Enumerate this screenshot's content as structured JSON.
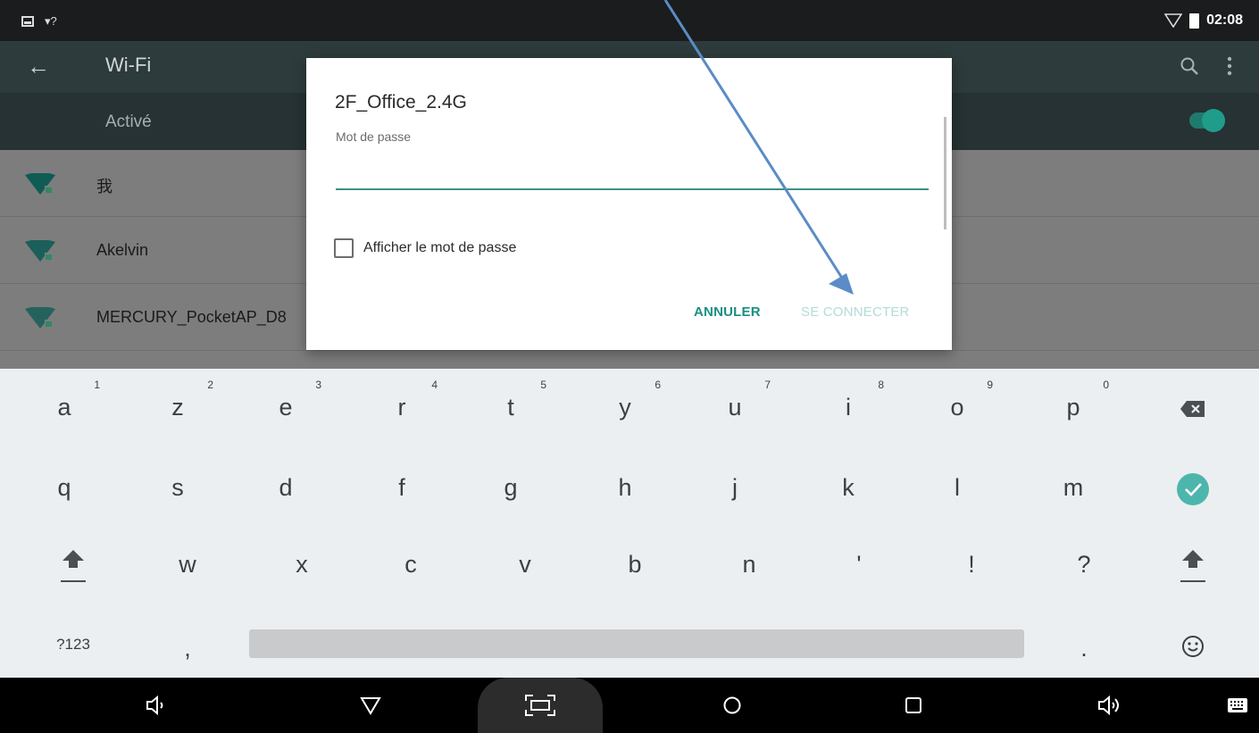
{
  "status_bar": {
    "time": "02:08",
    "icons": [
      "image-icon",
      "wifi-unknown-icon",
      "signal-icon",
      "battery-icon"
    ]
  },
  "action_bar": {
    "title": "Wi-Fi",
    "icons": [
      "back-arrow-icon",
      "search-icon",
      "more-vert-icon"
    ]
  },
  "switch_bar": {
    "label": "Activé",
    "enabled": true,
    "accent": "#1f9d8a"
  },
  "networks": [
    {
      "name": "我",
      "secured": true
    },
    {
      "name": "Akelvin",
      "secured": true
    },
    {
      "name": "MERCURY_PocketAP_D8",
      "secured": true
    }
  ],
  "dialog": {
    "title": "2F_Office_2.4G",
    "password_label": "Mot de passe",
    "password_value": "",
    "show_password_label": "Afficher le mot de passe",
    "show_password_checked": false,
    "cancel_label": "ANNULER",
    "connect_label": "SE CONNECTER",
    "accent": "#1a8f84"
  },
  "keyboard": {
    "row1": [
      {
        "key": "a",
        "hint": "1"
      },
      {
        "key": "z",
        "hint": "2"
      },
      {
        "key": "e",
        "hint": "3"
      },
      {
        "key": "r",
        "hint": "4"
      },
      {
        "key": "t",
        "hint": "5"
      },
      {
        "key": "y",
        "hint": "6"
      },
      {
        "key": "u",
        "hint": "7"
      },
      {
        "key": "i",
        "hint": "8"
      },
      {
        "key": "o",
        "hint": "9"
      },
      {
        "key": "p",
        "hint": "0"
      }
    ],
    "row2": [
      "q",
      "s",
      "d",
      "f",
      "g",
      "h",
      "j",
      "k",
      "l",
      "m"
    ],
    "row3": [
      "w",
      "x",
      "c",
      "v",
      "b",
      "n",
      "'",
      "!",
      "?"
    ],
    "symbols_label": "?123",
    "comma": ",",
    "period": ".",
    "icons": [
      "backspace-icon",
      "done-check-icon",
      "shift-icon",
      "emoji-icon"
    ]
  },
  "nav_bar": {
    "icons": [
      "volume-down-icon",
      "back-icon",
      "screenshot-icon",
      "home-icon",
      "recents-icon",
      "volume-up-icon",
      "keyboard-icon"
    ]
  }
}
